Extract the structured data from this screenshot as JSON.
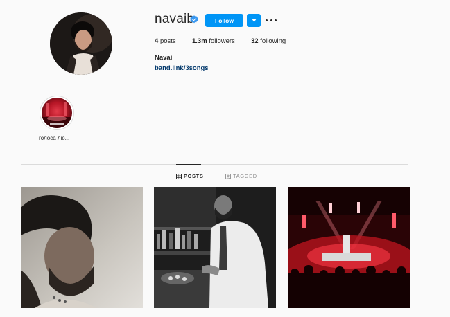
{
  "profile": {
    "username": "navaib",
    "follow_label": "Follow",
    "stats": {
      "posts_count": "4",
      "posts_label": "posts",
      "followers_count": "1.3m",
      "followers_label": "followers",
      "following_count": "32",
      "following_label": "following"
    },
    "full_name": "Navai",
    "bio_link": "band.link/3songs"
  },
  "highlights": [
    {
      "label": "голоса лю..."
    }
  ],
  "tabs": [
    {
      "label": "POSTS",
      "active": true
    },
    {
      "label": "TAGGED",
      "active": false
    }
  ],
  "colors": {
    "accent": "#0095f6",
    "link": "#00376b",
    "text": "#262626",
    "muted": "#8e8e8e",
    "background": "#fafafa"
  }
}
